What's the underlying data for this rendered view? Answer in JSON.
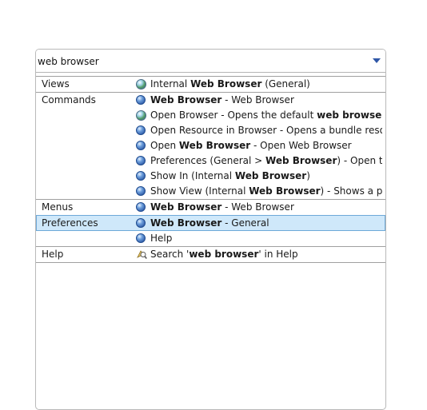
{
  "search": {
    "value": "web browser"
  },
  "rows": [
    {
      "category": "Views",
      "icon": "globe-icon",
      "pre": "Internal ",
      "bold": "Web Browser",
      "post": " (General)",
      "sep": true,
      "selected": false
    },
    {
      "category": "Commands",
      "icon": "command-icon",
      "pre": "",
      "bold": "Web Browser",
      "post": " - Web Browser",
      "sep": true,
      "selected": false
    },
    {
      "category": "",
      "icon": "globe-icon",
      "pre": "Open Browser - Opens the default ",
      "bold": "web browser",
      "post": ".",
      "sep": false,
      "selected": false
    },
    {
      "category": "",
      "icon": "command-icon",
      "pre": "Open Resource in Browser - Opens a bundle resource",
      "bold": "",
      "post": "",
      "sep": false,
      "selected": false
    },
    {
      "category": "",
      "icon": "command-icon",
      "pre": "Open ",
      "bold": "Web Browser",
      "post": " - Open Web Browser",
      "sep": false,
      "selected": false
    },
    {
      "category": "",
      "icon": "command-icon",
      "pre": "Preferences (General > ",
      "bold": "Web Browser",
      "post": ") - Open the pre",
      "sep": false,
      "selected": false
    },
    {
      "category": "",
      "icon": "command-icon",
      "pre": "Show In (Internal ",
      "bold": "Web Browser",
      "post": ")",
      "sep": false,
      "selected": false
    },
    {
      "category": "",
      "icon": "command-icon",
      "pre": "Show View (Internal ",
      "bold": "Web Browser",
      "post": ") - Shows a particu",
      "sep": false,
      "selected": false
    },
    {
      "category": "Menus",
      "icon": "command-icon",
      "pre": "",
      "bold": "Web Browser",
      "post": " - Web Browser",
      "sep": true,
      "selected": false
    },
    {
      "category": "Preferences",
      "icon": "command-icon",
      "pre": "",
      "bold": "Web Browser",
      "post": " - General",
      "sep": true,
      "selected": true
    },
    {
      "category": "",
      "icon": "command-icon",
      "pre": "Help",
      "bold": "",
      "post": "",
      "sep": false,
      "selected": false
    },
    {
      "category": "Help",
      "icon": "help-search-icon",
      "pre": "Search '",
      "bold": "web browser",
      "post": "' in Help",
      "sep": true,
      "selected": false
    }
  ]
}
